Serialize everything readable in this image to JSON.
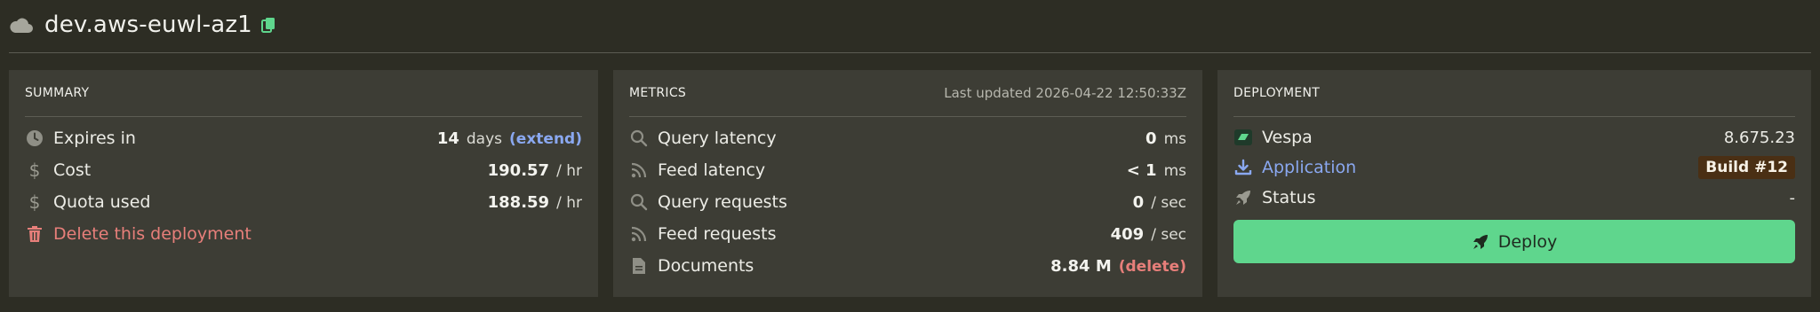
{
  "header": {
    "title": "dev.aws-euwl-az1",
    "icons": {
      "cloud": "cloud-icon",
      "copy": "copy-icon"
    }
  },
  "summary": {
    "title": "SUMMARY",
    "expires": {
      "label": "Expires in",
      "value": "14",
      "unit": "days",
      "action": "(extend)"
    },
    "cost": {
      "label": "Cost",
      "value": "190.57",
      "unit": "/ hr"
    },
    "quota": {
      "label": "Quota used",
      "value": "188.59",
      "unit": "/ hr"
    },
    "delete_label": "Delete this deployment"
  },
  "metrics": {
    "title": "METRICS",
    "last_updated": "Last updated 2026-04-22 12:50:33Z",
    "rows": [
      {
        "label": "Query latency",
        "value": "0",
        "unit": "ms",
        "icon": "search-icon"
      },
      {
        "label": "Feed latency",
        "value": "< 1",
        "unit": "ms",
        "icon": "rss-icon"
      },
      {
        "label": "Query requests",
        "value": "0",
        "unit": "/ sec",
        "icon": "search-icon"
      },
      {
        "label": "Feed requests",
        "value": "409",
        "unit": "/ sec",
        "icon": "rss-icon"
      },
      {
        "label": "Documents",
        "value": "8.84 M",
        "unit": "(delete)",
        "icon": "document-icon"
      }
    ]
  },
  "deployment": {
    "title": "DEPLOYMENT",
    "vespa": {
      "label": "Vespa",
      "value": "8.675.23"
    },
    "application": {
      "label": "Application",
      "value": "Build #12"
    },
    "status": {
      "label": "Status",
      "value": "-"
    },
    "deploy_label": "Deploy"
  },
  "colors": {
    "background": "#2d2d24",
    "panel": "#3d3d35",
    "accent_green": "#5fd68d",
    "link_blue": "#8aa8f0",
    "danger_red": "#e77f7a",
    "badge_brown": "#4a2f14"
  }
}
